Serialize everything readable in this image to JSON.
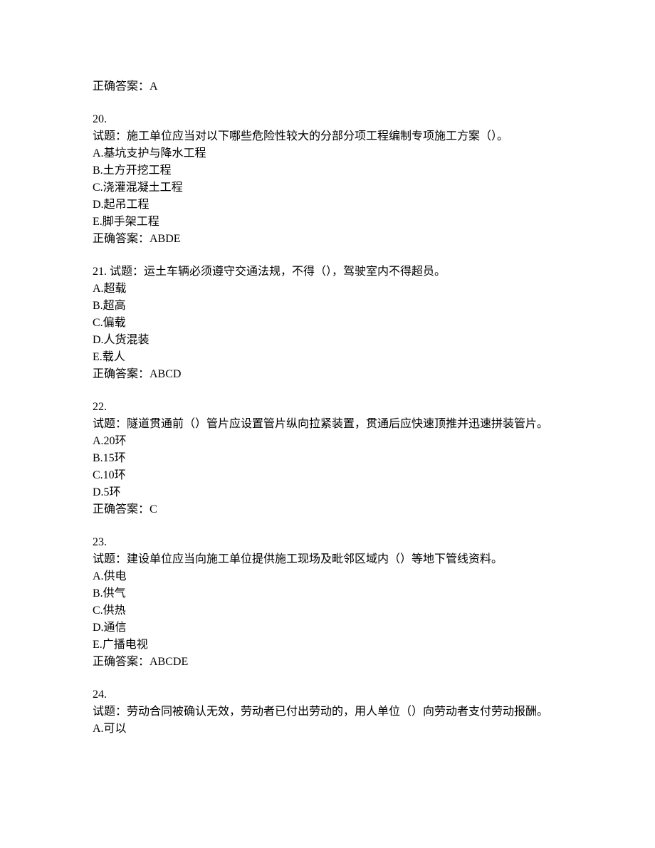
{
  "prevAnswer": "正确答案：A",
  "questions": [
    {
      "number": "20.",
      "stem": "试题：施工单位应当对以下哪些危险性较大的分部分项工程编制专项施工方案（）。",
      "options": [
        "A.基坑支护与降水工程",
        "B.土方开挖工程",
        "C.浇灌混凝土工程",
        "D.起吊工程",
        "E.脚手架工程"
      ],
      "answer": "正确答案：ABDE"
    },
    {
      "number": "21.",
      "stemInline": "试题：运土车辆必须遵守交通法规，不得（），驾驶室内不得超员。",
      "options": [
        "A.超载",
        "B.超高",
        "C.偏载",
        "D.人货混装",
        "E.载人"
      ],
      "answer": "正确答案：ABCD"
    },
    {
      "number": "22.",
      "stem": "试题：隧道贯通前（）管片应设置管片纵向拉紧装置，贯通后应快速顶推并迅速拼装管片。",
      "options": [
        "A.20环",
        "B.15环",
        "C.10环",
        "D.5环"
      ],
      "answer": "正确答案：C"
    },
    {
      "number": "23.",
      "stem": "试题：建设单位应当向施工单位提供施工现场及毗邻区域内（）等地下管线资料。",
      "options": [
        "A.供电",
        "B.供气",
        "C.供热",
        "D.通信",
        "E.广播电视"
      ],
      "answer": "正确答案：ABCDE"
    },
    {
      "number": "24.",
      "stem": "试题：劳动合同被确认无效，劳动者已付出劳动的，用人单位（）向劳动者支付劳动报酬。",
      "options": [
        "A.可以"
      ],
      "answer": ""
    }
  ]
}
